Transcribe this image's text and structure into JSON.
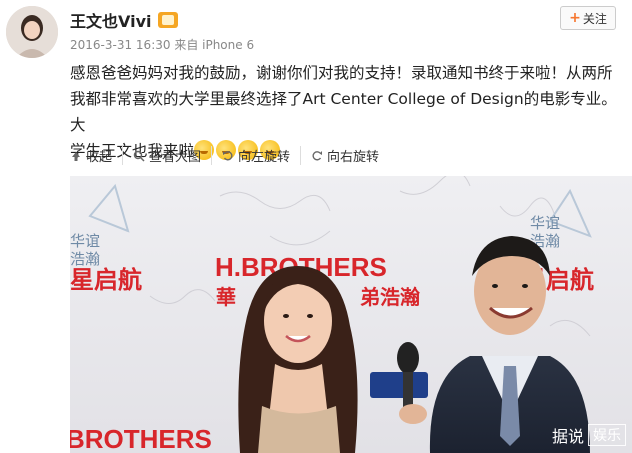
{
  "user": {
    "name": "王文也Vivi",
    "meta": "2016-3-31 16:30 来自 iPhone 6"
  },
  "follow_label": "关注",
  "post_text": {
    "line1": "感恩爸爸妈妈对我的鼓励，谢谢你们对我的支持！录取通知书终于来啦！从两所",
    "line2": "我都非常喜欢的大学里最终选择了Art Center College of Design的电影专业。大",
    "line3": "学生王文也我来啦"
  },
  "toolbar": {
    "collapse": "收起",
    "view_large": "查看大图",
    "rotate_left": "向左旋转",
    "rotate_right": "向右旋转"
  },
  "photo": {
    "backdrop": {
      "brand_main": "H.BROTHERS",
      "brand_cn": "華",
      "brand_cn2": "弟浩瀚",
      "left_cn": "星启航",
      "right_cn": "星启航",
      "right_top_cn1": "华谊",
      "right_top_cn2": "浩瀚",
      "left_top_cn1": "华谊",
      "left_top_cn2": "浩瀚",
      "bottom_left": "BROTHERS"
    },
    "watermark": {
      "brand": "据说",
      "tag": "娱乐"
    }
  },
  "colors": {
    "brand_red": "#d8262b",
    "link_orange": "#f7772f"
  }
}
